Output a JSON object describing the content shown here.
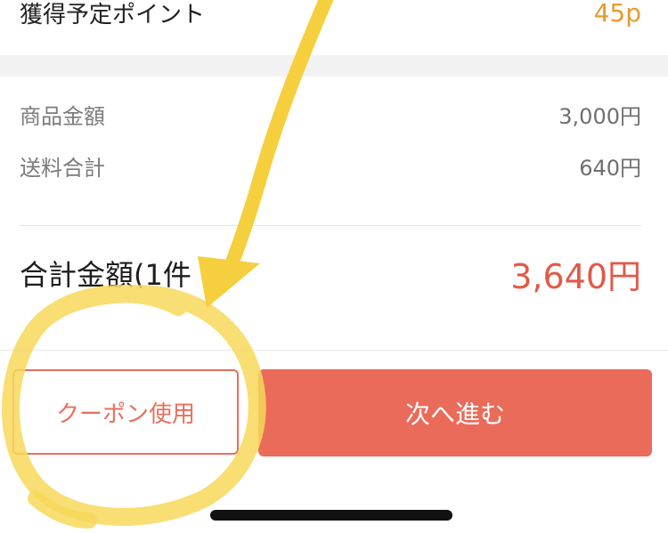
{
  "points": {
    "label": "獲得予定ポイント",
    "value": "45p"
  },
  "breakdown": [
    {
      "label": "商品金額",
      "value": "3,000円"
    },
    {
      "label": "送料合計",
      "value": "640円"
    }
  ],
  "total": {
    "label": "合計金額(1件",
    "value": "3,640円"
  },
  "buttons": {
    "coupon": "クーポン使用",
    "next": "次へ進む"
  },
  "colors": {
    "accent": "#ea6b5a",
    "points": "#e69b2d",
    "annotation": "#f5d24a"
  },
  "annotation_icons": [
    "arrow-annotation-icon",
    "circle-annotation-icon"
  ]
}
